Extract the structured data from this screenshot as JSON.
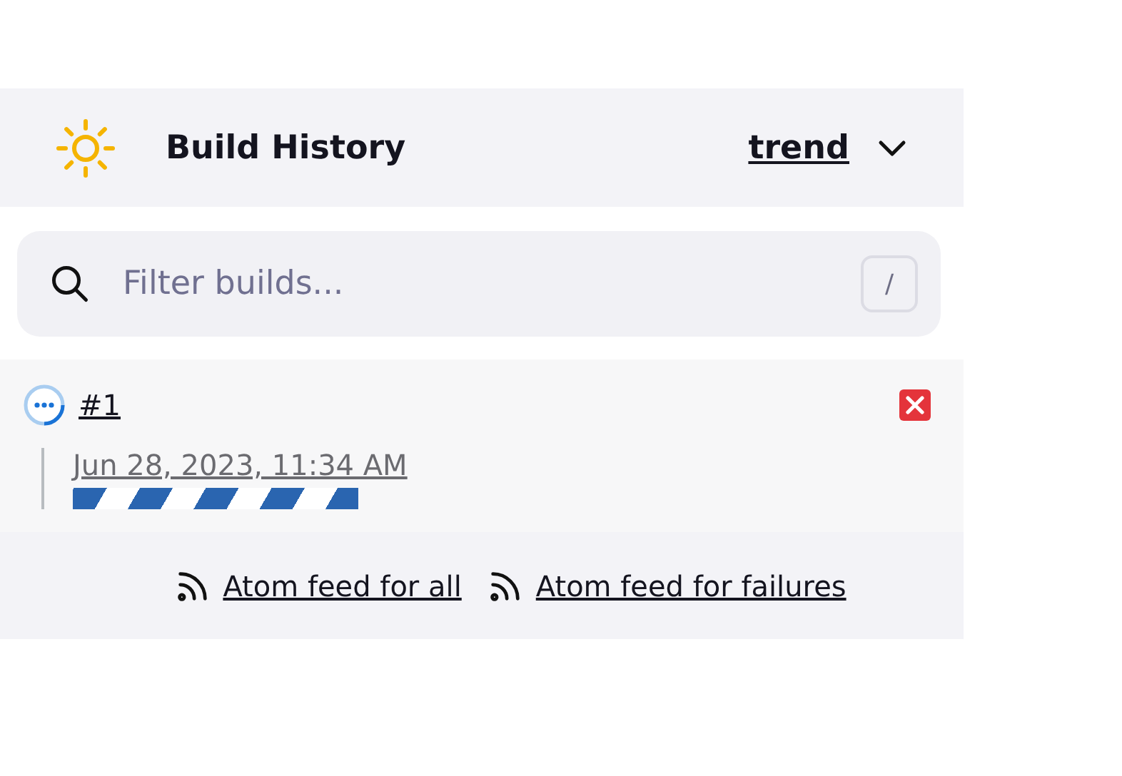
{
  "header": {
    "title": "Build History",
    "trend_link": "trend"
  },
  "search": {
    "placeholder": "Filter builds...",
    "shortcut": "/"
  },
  "builds": [
    {
      "number": "#1",
      "kind": "running",
      "timestamp": "Jun 28, 2023, 11:34 AM"
    }
  ],
  "feeds": [
    {
      "label": "Atom feed for all"
    },
    {
      "label": "Atom feed for failures"
    }
  ]
}
